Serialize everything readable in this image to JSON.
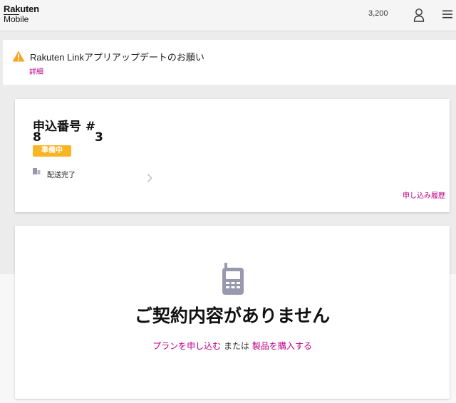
{
  "header": {
    "logo_line1": "Rakuten",
    "logo_line2": "Mobile",
    "points": "3,200",
    "icons": {
      "user": "user-icon",
      "menu": "menu-icon"
    }
  },
  "notice": {
    "icon": "warning-icon",
    "title": "Rakuten Linkアプリアップデートのお願い",
    "link": "詳細"
  },
  "order": {
    "label": "申込番号 #",
    "number_start": "8",
    "number_end": "3",
    "status": "準備中",
    "shipping_icon": "shipping-icon",
    "shipping_status": "配送完了",
    "history_link": "申し込み履歴"
  },
  "contract": {
    "icon": "phone-icon",
    "title": "ご契約内容がありません",
    "link_plan": "プランを申し込む",
    "conjunction": "または",
    "link_purchase": "製品を購入する"
  },
  "colors": {
    "accent": "#bf0087",
    "badge": "#f9b526",
    "warning": "#f5a623",
    "icon_gray": "#9a98ad"
  }
}
